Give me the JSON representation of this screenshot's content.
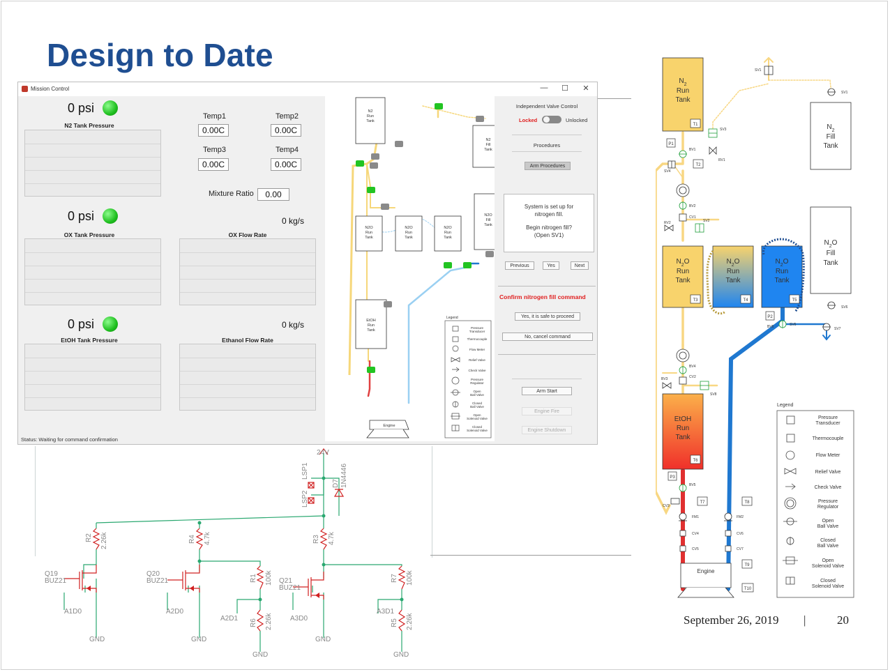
{
  "slide": {
    "title": "Design to Date",
    "footer_date": "September 26, 2019",
    "footer_separator": "|",
    "page_number": "20"
  },
  "window": {
    "title": "Mission Control",
    "controls": {
      "minimize": "—",
      "maximize": "☐",
      "close": "✕"
    }
  },
  "left_panel": {
    "n2": {
      "value": "0 psi",
      "label": "N2 Tank Pressure"
    },
    "ox": {
      "value": "0 psi",
      "label": "OX Tank Pressure",
      "flow_value": "0 kg/s",
      "flow_label": "OX Flow Rate"
    },
    "etoh": {
      "value": "0 psi",
      "label": "EtOH Tank Pressure",
      "flow_value": "0 kg/s",
      "flow_label": "Ethanol Flow Rate"
    },
    "temps": [
      {
        "label": "Temp1",
        "value": "0.00C"
      },
      {
        "label": "Temp2",
        "value": "0.00C"
      },
      {
        "label": "Temp3",
        "value": "0.00C"
      },
      {
        "label": "Temp4",
        "value": "0.00C"
      }
    ],
    "mixture_ratio": {
      "label": "Mixture Ratio",
      "value": "0.00"
    },
    "status": "Status: Waiting for command confirmation"
  },
  "right_panel": {
    "ivc_title": "Independent Valve Control",
    "locked": "Locked",
    "unlocked": "Unlocked",
    "procedures_label": "Procedures",
    "arm_procedures": "Arm Procedures",
    "message_line1": "System is set up for",
    "message_line2": "nitrogen fill.",
    "message_line3": "Begin nitrogen fill?",
    "message_line4": "(Open SV1)",
    "previous": "Previous",
    "yes": "Yes",
    "next": "Next",
    "confirm": "Confirm nitrogen fill command",
    "yes_safe": "Yes, it is safe to proceed",
    "no_cancel": "No, cancel command",
    "arm_start": "Arm Start",
    "engine_fire": "Engine Fire",
    "engine_shutdown": "Engine Shutdown"
  },
  "pid_small": {
    "tanks": {
      "n2_run": "N2 Run Tank",
      "n2_fill": "N2 Fill Tank",
      "n2o_run": "N2O Run Tank",
      "n2o_fill": "N2O Fill Tank",
      "etoh_run": "EtOH Run Tank",
      "engine": "Engine"
    },
    "legend_title": "Legend",
    "legend": [
      "Pressure Transducer",
      "Thermocouple",
      "Flow Meter",
      "Relief Valve",
      "Check Valve",
      "Pressure Regulator",
      "Open Ball Valve",
      "Closed Ball Valve",
      "Open Solenoid Valve",
      "Closed Solenoid Valve"
    ]
  },
  "pid_large": {
    "n2_run": [
      "N",
      "2",
      "Run",
      "Tank"
    ],
    "n2_fill": [
      "N",
      "2",
      "Fill",
      "Tank"
    ],
    "n2o_run": [
      "N",
      "2",
      "O",
      "Run",
      "Tank"
    ],
    "n2o_fill": [
      "N",
      "2",
      "O",
      "Fill",
      "Tank"
    ],
    "etoh_run": [
      "EtOH",
      "Run",
      "Tank"
    ],
    "engine": "Engine",
    "legend_title": "Legend",
    "legend": [
      {
        "sym": "P",
        "label": [
          "Pressure",
          "Transducer"
        ]
      },
      {
        "sym": "T",
        "label": [
          "Thermocouple"
        ]
      },
      {
        "sym": "flow",
        "label": [
          "Flow Meter"
        ]
      },
      {
        "sym": "relief",
        "label": [
          "Relief Valve"
        ]
      },
      {
        "sym": "check",
        "label": [
          "Check Valve"
        ]
      },
      {
        "sym": "reg",
        "label": [
          "Pressure",
          "Regulator"
        ]
      },
      {
        "sym": "obv",
        "label": [
          "Open",
          "Ball Valve"
        ]
      },
      {
        "sym": "cbv",
        "label": [
          "Closed",
          "Ball Valve"
        ]
      },
      {
        "sym": "osv",
        "label": [
          "Open",
          "Solenoid Valve"
        ]
      },
      {
        "sym": "csv",
        "label": [
          "Closed",
          "Solenoid Valve"
        ]
      }
    ],
    "tags": {
      "T1": "T1",
      "T2": "T2",
      "T3": "T3",
      "T4": "T4",
      "T5": "T5",
      "T6": "T6",
      "T7": "T7",
      "T8": "T8",
      "T9": "T9",
      "T10": "T10",
      "P1": "P1",
      "P2": "P2",
      "P3": "P3",
      "SV1": "SV1",
      "SV2": "SV2",
      "SV3": "SV3",
      "SV4": "SV4",
      "SV5": "SV5",
      "SV6": "SV6",
      "SV7": "SV7",
      "SV8": "SV8",
      "BV1": "BV1",
      "BV2": "BV2",
      "BV3": "BV3",
      "BV4": "BV4",
      "BV5": "BV5",
      "BV6": "BV6",
      "RV1": "RV1",
      "RV2": "RV2",
      "RV3": "RV3",
      "CV1": "CV1",
      "CV2": "CV2",
      "CV3": "CV3",
      "CV4": "CV4",
      "CV5": "CV5",
      "CV6": "CV6",
      "CV7": "CV7",
      "FM1": "FM1",
      "FM2": "FM2"
    }
  },
  "schematic": {
    "supply": "24V",
    "lsp1": "LSP1",
    "lsp2": "LSP2",
    "d_name": "D7",
    "d_part": "1N4446",
    "r2": "R2",
    "r2v": "2.26k",
    "r4": "R4",
    "r4v": "4.7k",
    "r3": "R3",
    "r3v": "4.7k",
    "r1": "R1",
    "r1v": "100k",
    "r6": "R6",
    "r6v": "2.26k",
    "r7": "R7",
    "r7v": "100k",
    "r5": "R5",
    "r5v": "2.26k",
    "q19": "Q19",
    "q20": "Q20",
    "q21": "Q21",
    "buz": "BUZ21",
    "a1d0": "A1D0",
    "a2d0": "A2D0",
    "a2d1": "A2D1",
    "a3d0": "A3D0",
    "a3d1": "A3D1",
    "gnd": "GND"
  }
}
